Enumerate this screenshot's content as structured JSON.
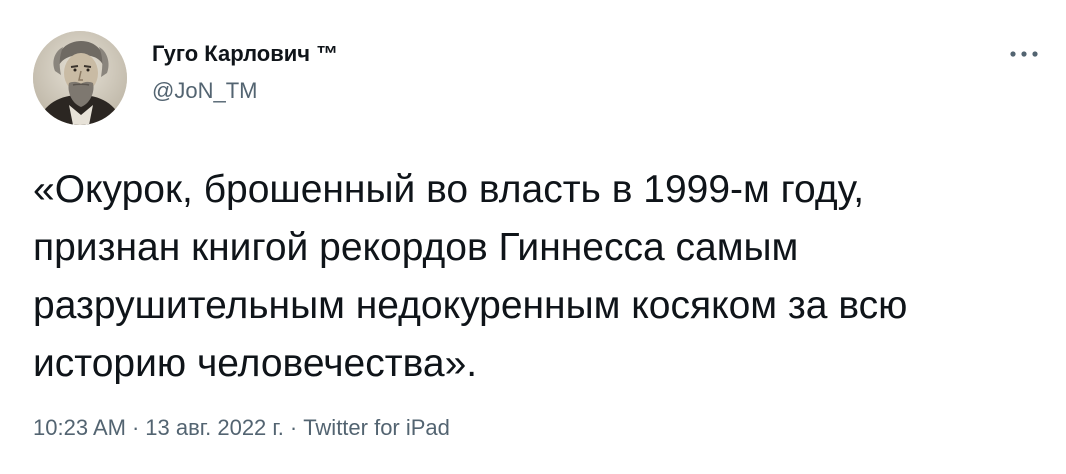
{
  "author": {
    "display_name": "Гуго Карлович ™",
    "handle": "@JoN_TM",
    "avatar_icon": "portrait-avatar"
  },
  "menu": {
    "more_icon": "more-horizontal-icon"
  },
  "tweet": {
    "text": "«Окурок, брошенный во власть в 1999-м году,\nпризнан книгой рекордов Гиннесса самым\nразрушительным недокуренным косяком за всю\nисторию человечества»."
  },
  "meta": {
    "time": "10:23 AM",
    "separator": "·",
    "date": "13 авг. 2022 г.",
    "source": "Twitter for iPad"
  },
  "colors": {
    "text_primary": "#0f1419",
    "text_secondary": "#536471",
    "background": "#ffffff"
  }
}
